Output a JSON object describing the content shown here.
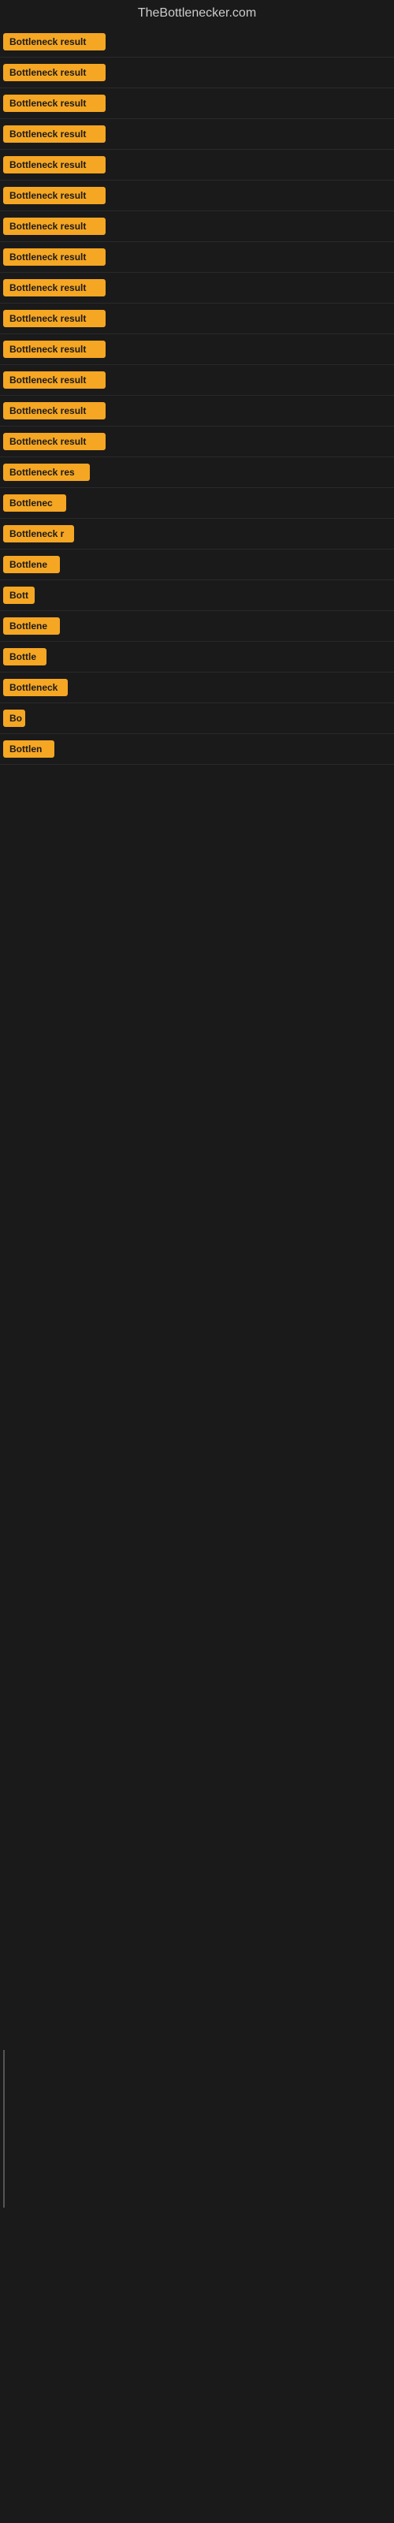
{
  "header": {
    "title": "TheBottlenecker.com"
  },
  "items": [
    {
      "label": "Bottleneck result",
      "width": 130
    },
    {
      "label": "Bottleneck result",
      "width": 130
    },
    {
      "label": "Bottleneck result",
      "width": 130
    },
    {
      "label": "Bottleneck result",
      "width": 130
    },
    {
      "label": "Bottleneck result",
      "width": 130
    },
    {
      "label": "Bottleneck result",
      "width": 130
    },
    {
      "label": "Bottleneck result",
      "width": 130
    },
    {
      "label": "Bottleneck result",
      "width": 130
    },
    {
      "label": "Bottleneck result",
      "width": 130
    },
    {
      "label": "Bottleneck result",
      "width": 130
    },
    {
      "label": "Bottleneck result",
      "width": 130
    },
    {
      "label": "Bottleneck result",
      "width": 130
    },
    {
      "label": "Bottleneck result",
      "width": 130
    },
    {
      "label": "Bottleneck result",
      "width": 130
    },
    {
      "label": "Bottleneck res",
      "width": 110
    },
    {
      "label": "Bottlenec",
      "width": 80
    },
    {
      "label": "Bottleneck r",
      "width": 90
    },
    {
      "label": "Bottlene",
      "width": 72
    },
    {
      "label": "Bott",
      "width": 40
    },
    {
      "label": "Bottlene",
      "width": 72
    },
    {
      "label": "Bottle",
      "width": 55
    },
    {
      "label": "Bottleneck",
      "width": 82
    },
    {
      "label": "Bo",
      "width": 28
    },
    {
      "label": "Bottlen",
      "width": 65
    }
  ]
}
